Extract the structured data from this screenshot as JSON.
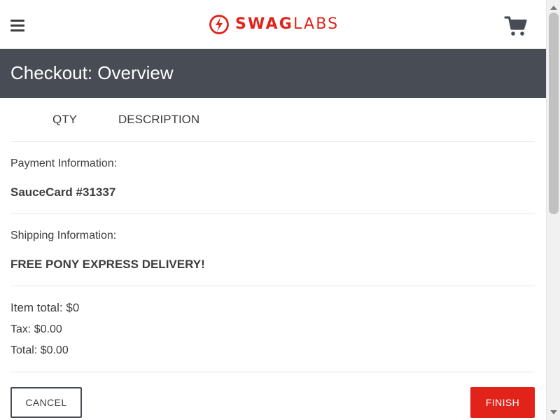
{
  "header": {
    "brand_bold": "SWAG",
    "brand_light": "LABS",
    "menu_icon": "hamburger-menu-icon",
    "cart_icon": "shopping-cart-icon",
    "brand_color": "#e2231a"
  },
  "subheader": {
    "title": "Checkout: Overview",
    "background": "#474c55"
  },
  "cart_list": {
    "headings": {
      "qty": "QTY",
      "description": "DESCRIPTION"
    }
  },
  "payment": {
    "label": "Payment Information:",
    "value": "SauceCard #31337"
  },
  "shipping": {
    "label": "Shipping Information:",
    "value": "FREE PONY EXPRESS DELIVERY!"
  },
  "summary": {
    "item_total": "Item total: $0",
    "tax": "Tax: $0.00",
    "total": "Total: $0.00"
  },
  "actions": {
    "cancel_label": "CANCEL",
    "finish_label": "FINISH",
    "finish_color": "#e2231a"
  }
}
